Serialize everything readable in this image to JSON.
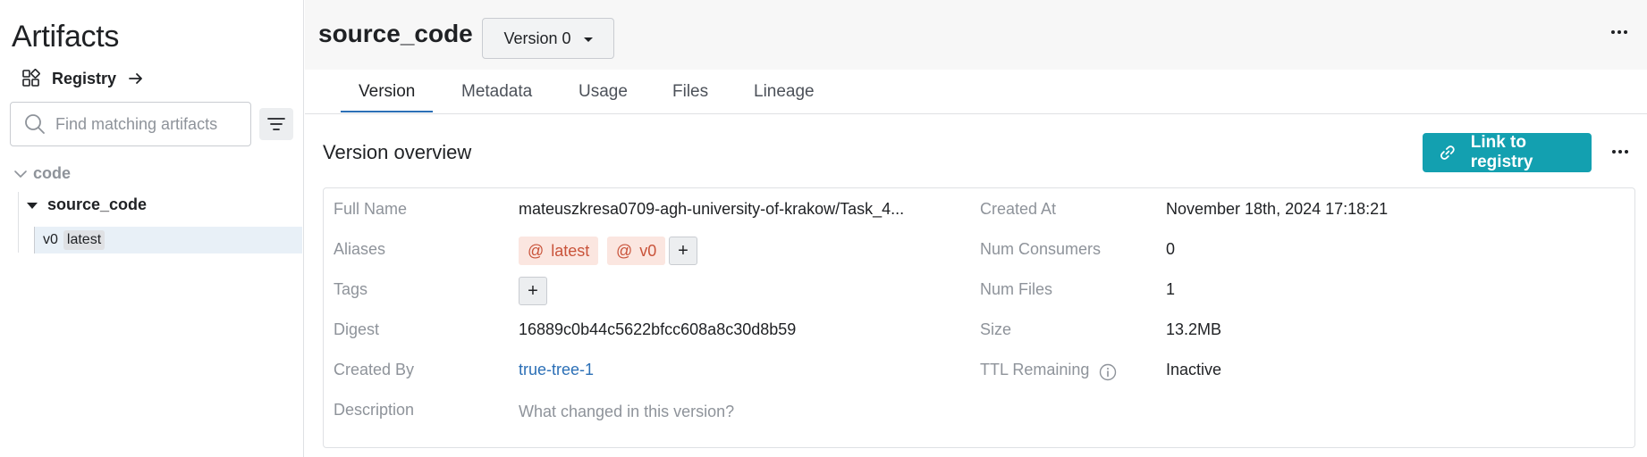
{
  "sidebar": {
    "title": "Artifacts",
    "registry_label": "Registry",
    "search_placeholder": "Find matching artifacts",
    "tree": {
      "group": "code",
      "artifact": "source_code",
      "version": "v0",
      "version_tag": "latest"
    }
  },
  "header": {
    "title": "source_code",
    "version_select": "Version 0"
  },
  "tabs": [
    "Version",
    "Metadata",
    "Usage",
    "Files",
    "Lineage"
  ],
  "overview": {
    "title": "Version overview",
    "link_button": "Link to registry",
    "fields_left": {
      "full_name_label": "Full Name",
      "full_name_value": "mateuszkresa0709-agh-university-of-krakow/Task_4...",
      "aliases_label": "Aliases",
      "aliases": [
        {
          "symbol": "@",
          "name": "latest"
        },
        {
          "symbol": "@",
          "name": "v0"
        }
      ],
      "alias_add": "+",
      "tags_label": "Tags",
      "tags_add": "+",
      "digest_label": "Digest",
      "digest_value": "16889c0b44c5622bfcc608a8c30d8b59",
      "created_by_label": "Created By",
      "created_by_value": "true-tree-1",
      "description_label": "Description",
      "description_placeholder": "What changed in this version?"
    },
    "fields_right": {
      "created_at_label": "Created At",
      "created_at_value": "November 18th, 2024 17:18:21",
      "num_consumers_label": "Num Consumers",
      "num_consumers_value": "0",
      "num_files_label": "Num Files",
      "num_files_value": "1",
      "size_label": "Size",
      "size_value": "13.2MB",
      "ttl_label": "TTL Remaining",
      "ttl_value": "Inactive"
    }
  },
  "colors": {
    "accent_teal": "#13a0b0",
    "link_blue": "#2b6fb6",
    "alias_bg": "#fbe6e0",
    "alias_fg": "#c9533a"
  },
  "icons": [
    "registry-icon",
    "arrow-right-icon",
    "search-icon",
    "filter-icon",
    "chevron-down-icon",
    "caret-down-icon",
    "more-icon",
    "link-icon",
    "info-icon"
  ]
}
